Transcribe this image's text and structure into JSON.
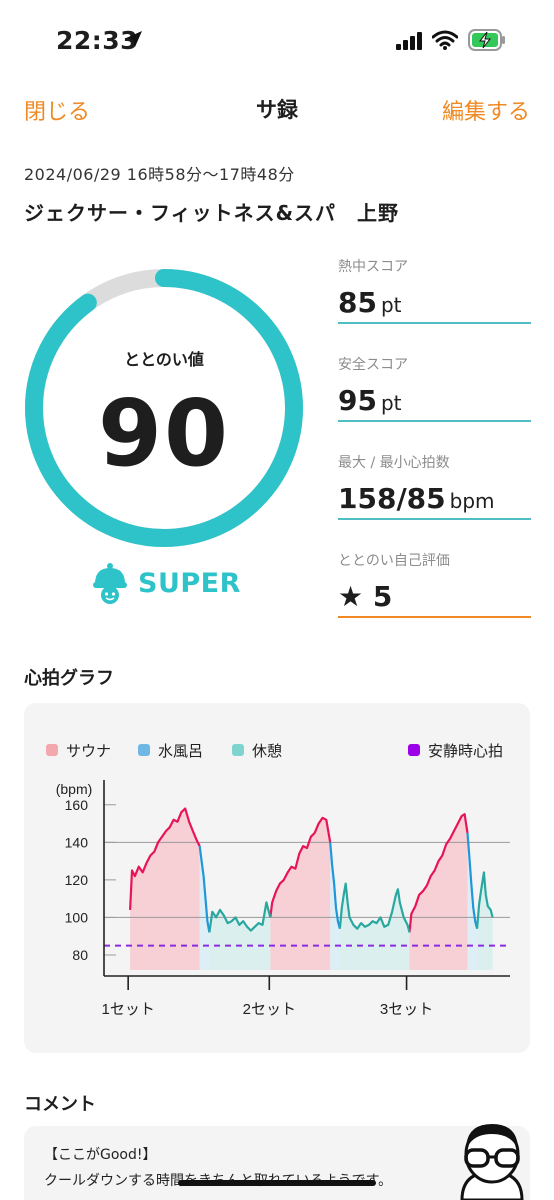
{
  "status_bar": {
    "time": "22:33",
    "icons": [
      "location-arrow-icon",
      "signal-icon",
      "wifi-icon",
      "battery-charging-icon"
    ]
  },
  "nav": {
    "close_label": "閉じる",
    "title": "サ録",
    "edit_label": "編集する"
  },
  "session": {
    "time_range": "2024/06/29 16時58分〜17時48分",
    "facility": "ジェクサー・フィットネス&スパ　上野"
  },
  "totonoi": {
    "label": "ととのい値",
    "value": "90",
    "progress": 0.9,
    "rank_label": "SUPER",
    "rank_icon": "sauna-hat-icon"
  },
  "scores": {
    "heat": {
      "label": "熱中スコア",
      "value": "85",
      "unit": "pt"
    },
    "safety": {
      "label": "安全スコア",
      "value": "95",
      "unit": "pt"
    },
    "heart_rate": {
      "label": "最大 / 最小心拍数",
      "value": "158/85",
      "unit": "bpm"
    },
    "self_eval": {
      "label": "ととのい自己評価",
      "star": "★",
      "value": "5"
    }
  },
  "graph": {
    "title": "心拍グラフ"
  },
  "colors": {
    "accent_orange": "#f08a24",
    "teal": "#2ec3c9",
    "sauna": "#e8145a",
    "cold_bath": "#2196d8",
    "rest": "#28a8a0",
    "resting_hr": "#8a2be2"
  },
  "chart_data": {
    "type": "line",
    "ylabel": "(bpm)",
    "y_ticks": [
      "160",
      "140",
      "120",
      "100",
      "80"
    ],
    "ylim": [
      72,
      170
    ],
    "x_ticks": [
      "1セット",
      "2セット",
      "3セット"
    ],
    "xlim": [
      0,
      420
    ],
    "grid": "horizontal",
    "legend": [
      {
        "name": "サウナ",
        "color": "#f2a8ad"
      },
      {
        "name": "水風呂",
        "color": "#6fb8e6"
      },
      {
        "name": "休憩",
        "color": "#7fd4cf"
      },
      {
        "name": "安静時心拍",
        "color": "#9b00e8"
      }
    ],
    "resting_hr": 85,
    "series": [
      {
        "name": "サウナ",
        "color": "#e8145a",
        "fill": "#f6c9cf",
        "segments": [
          [
            [
              27,
              104
            ],
            [
              29,
              125
            ],
            [
              32,
              122
            ],
            [
              36,
              127
            ],
            [
              40,
              124
            ],
            [
              44,
              129
            ],
            [
              48,
              133
            ],
            [
              52,
              135
            ],
            [
              56,
              140
            ],
            [
              60,
              143
            ],
            [
              64,
              146
            ],
            [
              68,
              148
            ],
            [
              72,
              152
            ],
            [
              76,
              151
            ],
            [
              80,
              156
            ],
            [
              84,
              158
            ],
            [
              88,
              151
            ],
            [
              92,
              146
            ],
            [
              96,
              141
            ],
            [
              99,
              138
            ]
          ],
          [
            [
              172,
              100
            ],
            [
              174,
              108
            ],
            [
              178,
              114
            ],
            [
              182,
              118
            ],
            [
              186,
              120
            ],
            [
              190,
              124
            ],
            [
              194,
              127
            ],
            [
              198,
              126
            ],
            [
              202,
              134
            ],
            [
              206,
              138
            ],
            [
              210,
              137
            ],
            [
              214,
              143
            ],
            [
              218,
              145
            ],
            [
              222,
              150
            ],
            [
              226,
              153
            ],
            [
              230,
              152
            ],
            [
              234,
              140
            ]
          ],
          [
            [
              316,
              92
            ],
            [
              318,
              102
            ],
            [
              322,
              106
            ],
            [
              326,
              112
            ],
            [
              330,
              114
            ],
            [
              334,
              117
            ],
            [
              338,
              122
            ],
            [
              342,
              125
            ],
            [
              346,
              130
            ],
            [
              350,
              133
            ],
            [
              354,
              139
            ],
            [
              358,
              142
            ],
            [
              362,
              146
            ],
            [
              366,
              150
            ],
            [
              370,
              154
            ],
            [
              373,
              155
            ],
            [
              376,
              145
            ]
          ]
        ]
      },
      {
        "name": "水風呂",
        "color": "#2196d8",
        "fill": "#d9ecf6",
        "segments": [
          [
            [
              99,
              138
            ],
            [
              101,
              130
            ],
            [
              103,
              122
            ],
            [
              105,
              110
            ],
            [
              107,
              98
            ],
            [
              109,
              92
            ]
          ],
          [
            [
              234,
              140
            ],
            [
              236,
              128
            ],
            [
              238,
              118
            ],
            [
              240,
              105
            ],
            [
              242,
              98
            ],
            [
              244,
              94
            ]
          ],
          [
            [
              376,
              145
            ],
            [
              378,
              132
            ],
            [
              380,
              118
            ],
            [
              382,
              105
            ],
            [
              384,
              98
            ],
            [
              386,
              94
            ]
          ]
        ]
      },
      {
        "name": "休憩",
        "color": "#28a8a0",
        "fill": "#d6efec",
        "segments": [
          [
            [
              109,
              92
            ],
            [
              112,
              103
            ],
            [
              116,
              100
            ],
            [
              120,
              104
            ],
            [
              124,
              101
            ],
            [
              128,
              97
            ],
            [
              132,
              98
            ],
            [
              136,
              100
            ],
            [
              140,
              96
            ],
            [
              144,
              98
            ],
            [
              148,
              95
            ],
            [
              152,
              93
            ],
            [
              156,
              95
            ],
            [
              160,
              97
            ],
            [
              164,
              96
            ],
            [
              168,
              108
            ],
            [
              172,
              100
            ]
          ],
          [
            [
              244,
              94
            ],
            [
              246,
              105
            ],
            [
              248,
              112
            ],
            [
              250,
              118
            ],
            [
              252,
              108
            ],
            [
              254,
              100
            ],
            [
              258,
              96
            ],
            [
              262,
              94
            ],
            [
              266,
              97
            ],
            [
              270,
              95
            ],
            [
              274,
              96
            ],
            [
              278,
              98
            ],
            [
              282,
              97
            ],
            [
              286,
              100
            ],
            [
              290,
              95
            ],
            [
              294,
              96
            ],
            [
              298,
              103
            ],
            [
              302,
              112
            ],
            [
              304,
              115
            ],
            [
              306,
              108
            ],
            [
              310,
              100
            ],
            [
              314,
              96
            ],
            [
              316,
              92
            ]
          ],
          [
            [
              386,
              94
            ],
            [
              388,
              107
            ],
            [
              390,
              114
            ],
            [
              393,
              124
            ],
            [
              395,
              112
            ],
            [
              397,
              106
            ],
            [
              400,
              104
            ],
            [
              402,
              100
            ]
          ]
        ]
      }
    ]
  },
  "comment": {
    "title": "コメント",
    "lines": [
      "【ここがGood!】",
      "クールダウンする時間をきちんと取れているようです。"
    ],
    "avatar_icon": "glasses-character-icon"
  }
}
